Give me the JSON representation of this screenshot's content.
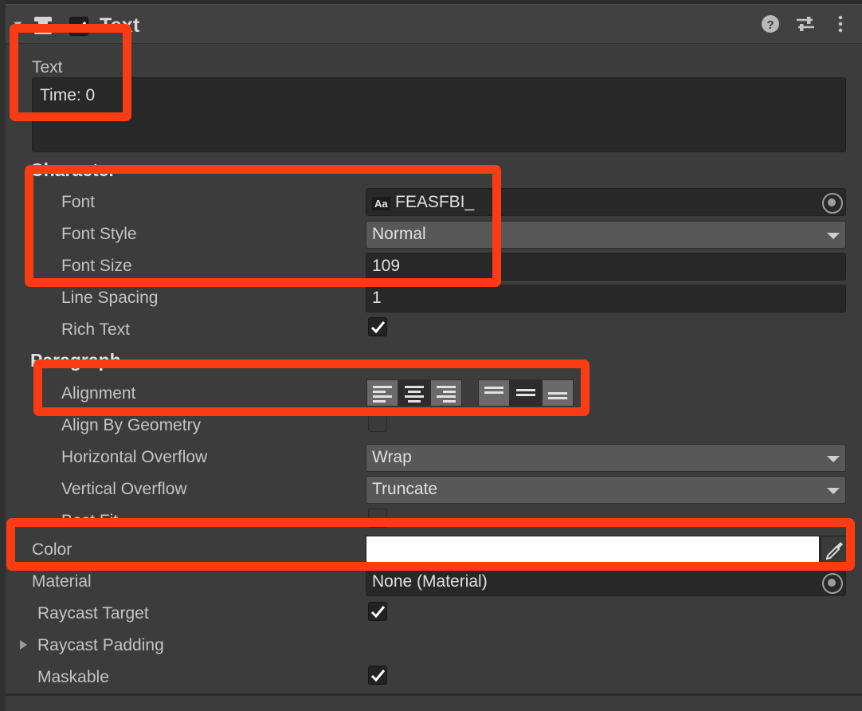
{
  "window": {
    "component_title": "Text",
    "component_enabled": true,
    "header_icons": [
      {
        "name": "help-icon",
        "glyph": "?"
      },
      {
        "name": "preset-icon",
        "glyph": "sliders"
      },
      {
        "name": "more-menu-icon",
        "glyph": "kebab"
      }
    ]
  },
  "text_property": {
    "label": "Text",
    "value": "Time: 0"
  },
  "sections": {
    "character": {
      "title": "Character",
      "font": {
        "label": "Font",
        "value": "FEASFBI_",
        "badge": "Aa"
      },
      "font_style": {
        "label": "Font Style",
        "value": "Normal"
      },
      "font_size": {
        "label": "Font Size",
        "value": "109"
      },
      "line_spacing": {
        "label": "Line Spacing",
        "value": "1"
      },
      "rich_text": {
        "label": "Rich Text",
        "checked": true
      }
    },
    "paragraph": {
      "title": "Paragraph",
      "alignment": {
        "label": "Alignment",
        "horizontal_options": [
          "align-left",
          "align-center",
          "align-right"
        ],
        "horizontal_selected": 1,
        "vertical_options": [
          "align-top",
          "align-middle",
          "align-bottom"
        ],
        "vertical_selected": 1
      },
      "align_by_geometry": {
        "label": "Align By Geometry",
        "checked": false
      },
      "horizontal_overflow": {
        "label": "Horizontal Overflow",
        "value": "Wrap"
      },
      "vertical_overflow": {
        "label": "Vertical Overflow",
        "value": "Truncate"
      },
      "best_fit": {
        "label": "Best Fit",
        "checked": false
      }
    },
    "appearance": {
      "color": {
        "label": "Color",
        "value": "#FFFFFF"
      },
      "material": {
        "label": "Material",
        "value": "None (Material)"
      },
      "raycast_target": {
        "label": "Raycast Target",
        "checked": true
      },
      "raycast_padding": {
        "label": "Raycast Padding",
        "expanded": false
      },
      "maskable": {
        "label": "Maskable",
        "checked": true
      }
    }
  },
  "annotations": {
    "highlight_color": "#FA3C14",
    "boxes": [
      {
        "name": "text-value-highlight"
      },
      {
        "name": "font-block-highlight"
      },
      {
        "name": "alignment-highlight"
      },
      {
        "name": "color-highlight"
      }
    ]
  }
}
